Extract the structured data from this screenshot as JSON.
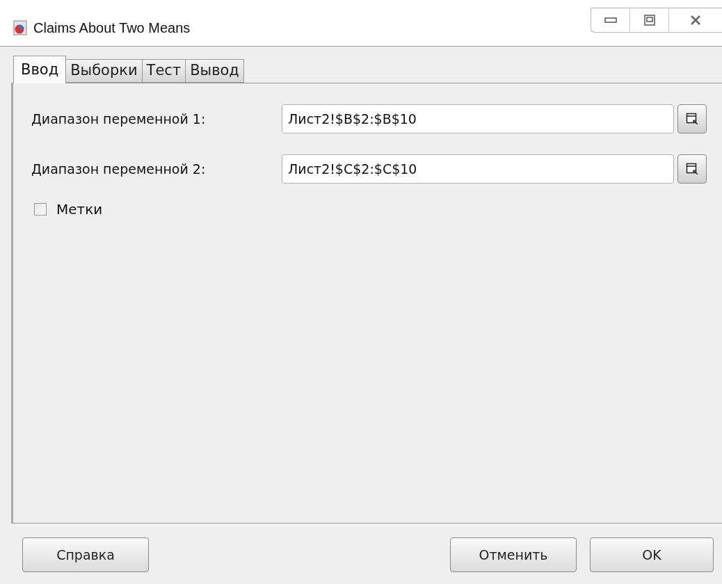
{
  "window": {
    "title": "Claims About Two Means"
  },
  "tabs": [
    {
      "label": "Ввод",
      "selected": true
    },
    {
      "label": "Выборки",
      "selected": false
    },
    {
      "label": "Тест",
      "selected": false
    },
    {
      "label": "Вывод",
      "selected": false
    }
  ],
  "ranges": [
    {
      "label": "Диапазон переменной 1:",
      "value": "Лист2!$B$2:$B$10"
    },
    {
      "label": "Диапазон переменной 2:",
      "value": "Лист2!$C$2:$C$10"
    }
  ],
  "labels_checkbox": {
    "label": "Метки",
    "checked": false
  },
  "buttons": {
    "help": "Справка",
    "cancel": "Отменить",
    "ok": "OK"
  }
}
